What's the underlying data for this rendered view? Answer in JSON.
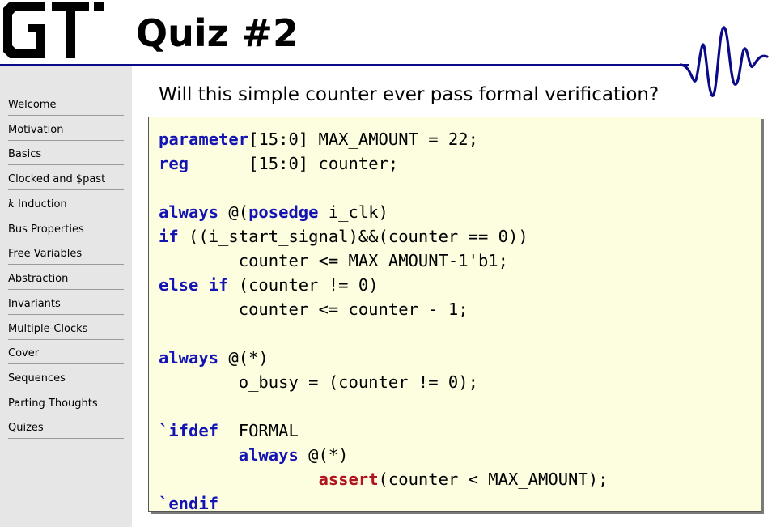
{
  "slide": {
    "title": "Quiz #2",
    "question": "Will this simple counter ever pass formal verification?"
  },
  "colors": {
    "keyword": "#1414b4",
    "assert": "#b0141e",
    "rule": "#0a0a8a",
    "code_background": "#fdfde0",
    "sidebar_background": "#e6e6e6"
  },
  "icons": {
    "logo": "gt-logo-icon",
    "wave": "waveform-icon"
  },
  "sidebar": {
    "items": [
      {
        "label": "Welcome"
      },
      {
        "label": "Motivation"
      },
      {
        "label": "Basics"
      },
      {
        "label": "Clocked and $past"
      },
      {
        "label": "k Induction",
        "prefix": "k",
        "rest": " Induction"
      },
      {
        "label": "Bus Properties"
      },
      {
        "label": "Free Variables"
      },
      {
        "label": "Abstraction"
      },
      {
        "label": "Invariants"
      },
      {
        "label": "Multiple-Clocks"
      },
      {
        "label": "Cover"
      },
      {
        "label": "Sequences"
      },
      {
        "label": "Parting Thoughts"
      },
      {
        "label": "Quizes"
      }
    ]
  },
  "code": {
    "lines": [
      [
        {
          "t": "parameter",
          "c": "kw"
        },
        {
          "t": "[15:0] MAX_AMOUNT = 22;"
        }
      ],
      [
        {
          "t": "reg",
          "c": "kw"
        },
        {
          "t": "      [15:0] counter;"
        }
      ],
      [],
      [
        {
          "t": "always",
          "c": "kw"
        },
        {
          "t": " @("
        },
        {
          "t": "posedge",
          "c": "kw"
        },
        {
          "t": " i_clk)"
        }
      ],
      [
        {
          "t": "if",
          "c": "kw"
        },
        {
          "t": " ((i_start_signal)&&(counter == 0))"
        }
      ],
      [
        {
          "t": "        counter <= MAX_AMOUNT-1'b1;"
        }
      ],
      [
        {
          "t": "else if",
          "c": "kw"
        },
        {
          "t": " (counter != 0)"
        }
      ],
      [
        {
          "t": "        counter <= counter - 1;"
        }
      ],
      [],
      [
        {
          "t": "always",
          "c": "kw"
        },
        {
          "t": " @(*)"
        }
      ],
      [
        {
          "t": "        o_busy = (counter != 0);"
        }
      ],
      [],
      [
        {
          "t": "`ifdef",
          "c": "kw"
        },
        {
          "t": "  FORMAL"
        }
      ],
      [
        {
          "t": "        "
        },
        {
          "t": "always",
          "c": "kw"
        },
        {
          "t": " @(*)"
        }
      ],
      [
        {
          "t": "                "
        },
        {
          "t": "assert",
          "c": "as"
        },
        {
          "t": "(counter < MAX_AMOUNT);"
        }
      ],
      [
        {
          "t": "`endif",
          "c": "kw"
        }
      ]
    ]
  }
}
